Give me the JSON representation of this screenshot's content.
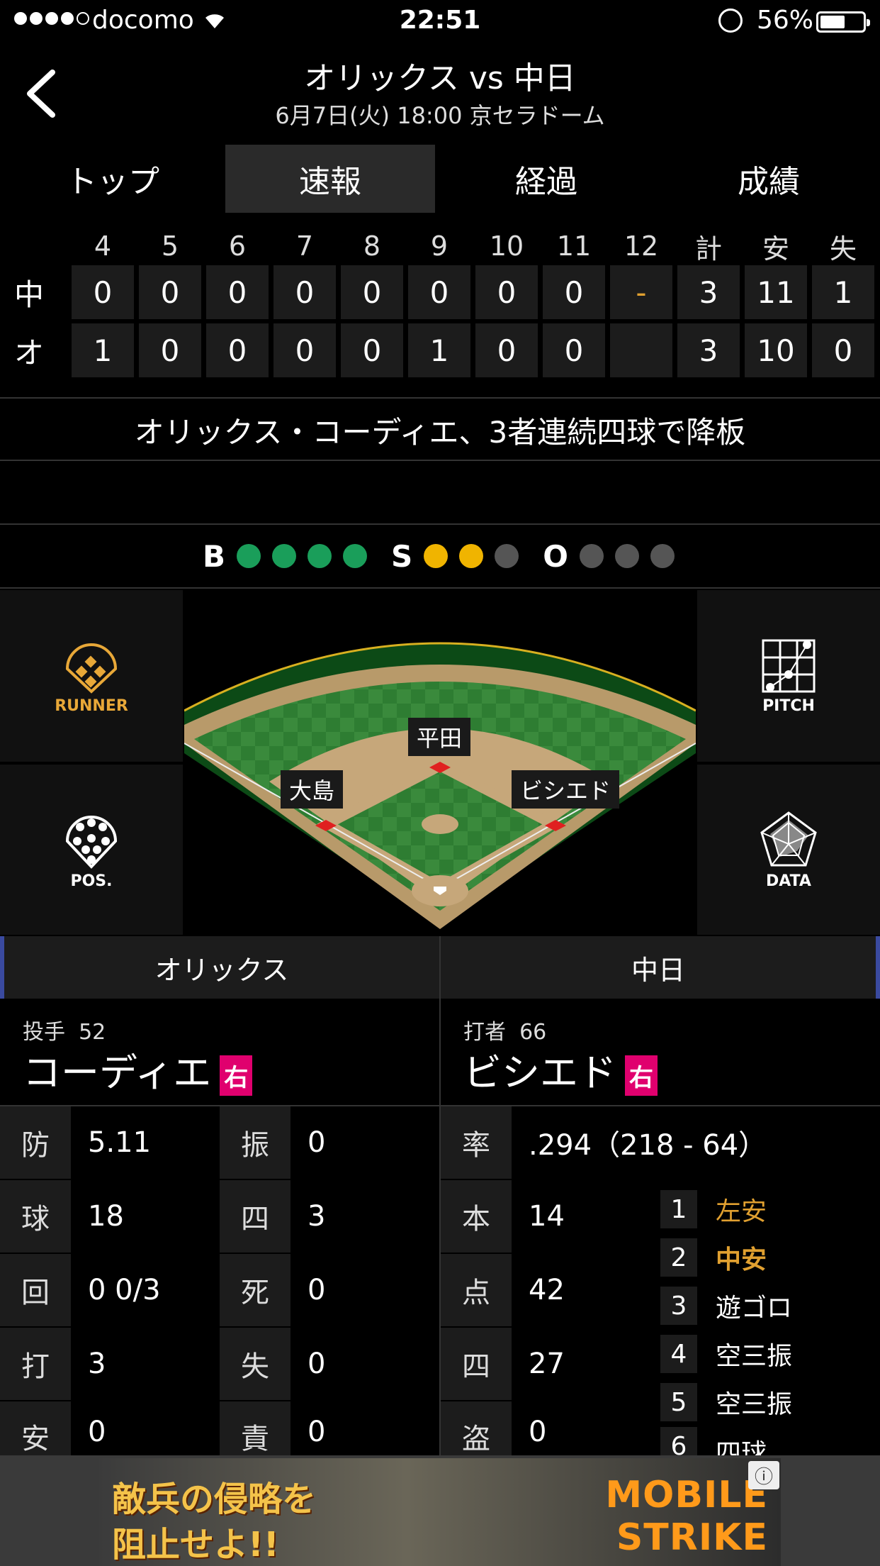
{
  "status": {
    "carrier": "docomo",
    "time": "22:51",
    "battery": "56%"
  },
  "header": {
    "title": "オリックス vs 中日",
    "subtitle": "6月7日(火) 18:00 京セラドーム"
  },
  "tabs": [
    {
      "label": "トップ"
    },
    {
      "label": "速報"
    },
    {
      "label": "経過"
    },
    {
      "label": "成績"
    }
  ],
  "scoreboard": {
    "headers": [
      "4",
      "5",
      "6",
      "7",
      "8",
      "9",
      "10",
      "11",
      "12",
      "計",
      "安",
      "失"
    ],
    "rows": [
      {
        "team": "中",
        "cells": [
          "0",
          "0",
          "0",
          "0",
          "0",
          "0",
          "0",
          "0",
          "-",
          "3",
          "11",
          "1"
        ]
      },
      {
        "team": "オ",
        "cells": [
          "1",
          "0",
          "0",
          "0",
          "0",
          "1",
          "0",
          "0",
          "",
          "3",
          "10",
          "0"
        ]
      }
    ]
  },
  "headline": "オリックス・コーディエ、3者連続四球で降板",
  "bso": {
    "b_label": "B",
    "s_label": "S",
    "o_label": "O",
    "balls": 4,
    "strikes": 2,
    "outs": 0
  },
  "side_buttons": {
    "runner": "RUNNER",
    "pitch": "PITCH",
    "pos": "POS.",
    "data": "DATA"
  },
  "field": {
    "runner_second": "平田",
    "runner_third": "大島",
    "runner_first": "ビシエド"
  },
  "teams": {
    "left": "オリックス",
    "right": "中日"
  },
  "pitcher": {
    "role": "投手",
    "number": "52",
    "name": "コーディエ",
    "hand": "右",
    "stats": [
      {
        "k": "防",
        "v": "5.11"
      },
      {
        "k": "振",
        "v": "0"
      },
      {
        "k": "球",
        "v": "18"
      },
      {
        "k": "四",
        "v": "3"
      },
      {
        "k": "回",
        "v": "0 0/3"
      },
      {
        "k": "死",
        "v": "0"
      },
      {
        "k": "打",
        "v": "3"
      },
      {
        "k": "失",
        "v": "0"
      },
      {
        "k": "安",
        "v": "0"
      },
      {
        "k": "責",
        "v": "0"
      }
    ]
  },
  "batter": {
    "role": "打者",
    "number": "66",
    "name": "ビシエド",
    "hand": "右",
    "avg_label": "率",
    "avg": ".294（218 - 64）",
    "stats": [
      {
        "k": "本",
        "v": "14"
      },
      {
        "k": "点",
        "v": "42"
      },
      {
        "k": "四",
        "v": "27"
      },
      {
        "k": "盗",
        "v": "0"
      }
    ],
    "history": [
      {
        "n": "1",
        "t": "左安"
      },
      {
        "n": "2",
        "t": "中安"
      },
      {
        "n": "3",
        "t": "遊ゴロ"
      },
      {
        "n": "4",
        "t": "空三振"
      },
      {
        "n": "5",
        "t": "空三振"
      },
      {
        "n": "6",
        "t": "四球"
      }
    ]
  },
  "ad": {
    "line1": "敵兵の侵略を",
    "line2": "阻止せよ!!",
    "brand1": "MOBILE",
    "brand2": "STRIKE"
  }
}
